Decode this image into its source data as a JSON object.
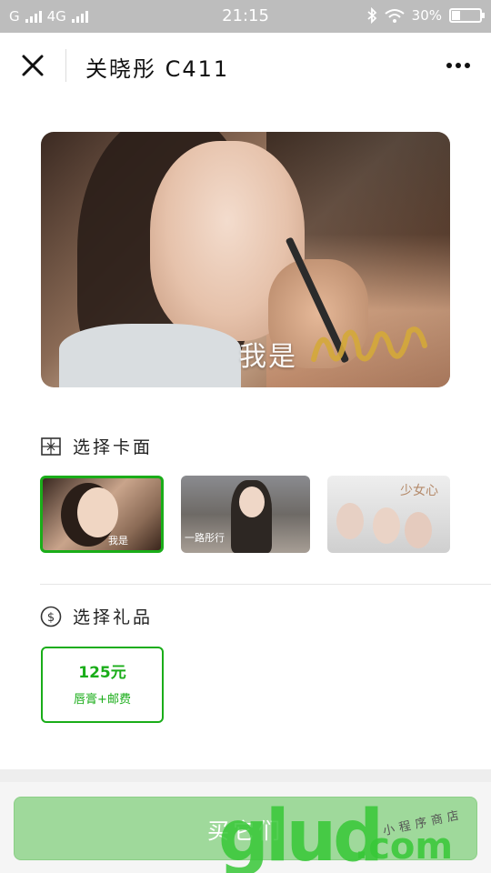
{
  "status_bar": {
    "carrier1": "G",
    "carrier2": "4G",
    "time": "21:15",
    "battery": "30%",
    "battery_level": 0.3,
    "icons": [
      "signal-icon",
      "bluetooth-icon",
      "wifi-icon",
      "battery-icon"
    ]
  },
  "nav": {
    "title": "关晓彤 C411",
    "close_icon": "close-icon",
    "more_icon": "more-icon"
  },
  "hero": {
    "caption": "我是",
    "script_text": "小公举"
  },
  "card_section": {
    "title": "选择卡面",
    "icon": "gift-icon",
    "cards": [
      {
        "text": "我是",
        "selected": true
      },
      {
        "text": "一路彤行",
        "selected": false
      },
      {
        "text": "少女心",
        "selected": false
      }
    ]
  },
  "gift_section": {
    "title": "选择礼品",
    "icon": "dollar-icon",
    "options": [
      {
        "price": "125元",
        "desc": "唇膏+邮费",
        "selected": true
      }
    ]
  },
  "buy_button": {
    "label": "买它们"
  },
  "watermark": {
    "main": "glud",
    "dotcom": ".com",
    "sub": "小程序商店"
  },
  "colors": {
    "accent": "#1aad19",
    "button_disabled": "#9fd99b",
    "status_bar": "#bdbdbd"
  }
}
